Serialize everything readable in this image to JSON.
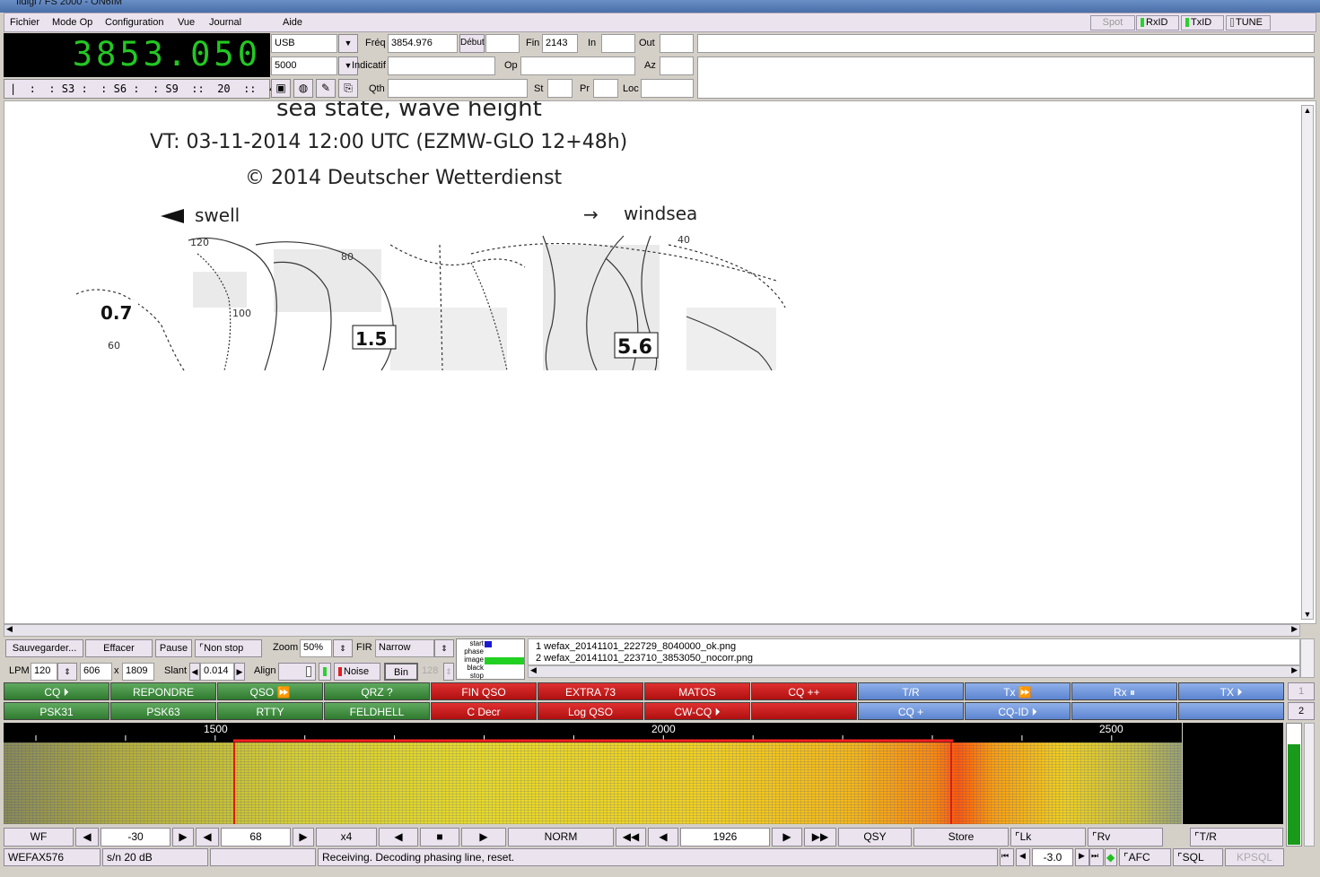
{
  "window": {
    "title": "fldigi / FS 2000 - ON6IM"
  },
  "menu": {
    "items": [
      "Fichier",
      "Mode Op",
      "Configuration",
      "Vue",
      "Journal",
      "Aide"
    ]
  },
  "indicators": {
    "spot": "Spot",
    "rxid": "RxID",
    "txid": "TxID",
    "tune": "TUNE"
  },
  "rig": {
    "frequency": "3853.050",
    "smeter": "|  :  : S3 :  : S6 :  : S9  ::  20  ::  40  ::  |",
    "mode": "USB",
    "bandwidth": "5000"
  },
  "log": {
    "freq_label": "Fréq",
    "freq_value": "3854.976",
    "debut_label": "Début",
    "debut_value": "",
    "fin_label": "Fin",
    "fin_value": "2143",
    "in_label": "In",
    "out_label": "Out",
    "call_label": "Indicatif",
    "op_label": "Op",
    "az_label": "Az",
    "qth_label": "Qth",
    "st_label": "St",
    "pr_label": "Pr",
    "loc_label": "Loc"
  },
  "fax": {
    "line1": "sea state, wave height",
    "line2": "VT: 03-11-2014 12:00 UTC (EZMW-GLO 12+48h)",
    "line3": "© 2014 Deutscher Wetterdienst",
    "legend_swell": "swell",
    "legend_windsea": "windsea",
    "v1": "0.7",
    "v2": "1.5",
    "v3": "5.6",
    "n1": "80",
    "n2": "100",
    "n3": "120",
    "n4": "60",
    "n5": "40"
  },
  "faxctl": {
    "save": "Sauvegarder...",
    "erase": "Effacer",
    "pause": "Pause",
    "nonstop": "Non stop",
    "zoom_label": "Zoom",
    "zoom_value": "50%",
    "fir_label": "FIR",
    "fir_value": "Narrow",
    "lpm_label": "LPM",
    "lpm_value": "120",
    "w_value": "606",
    "x_label": "x",
    "h_value": "1809",
    "slant_label": "Slant",
    "slant_value": "0.014",
    "align_label": "Align",
    "noise": "Noise",
    "bin": "Bin",
    "thresh": "128",
    "states": [
      "start",
      "phase",
      "image",
      "black",
      "stop"
    ],
    "files": [
      "1 wefax_20141101_222729_8040000_ok.png",
      "2 wefax_20141101_223710_3853050_nocorr.png"
    ]
  },
  "macros": {
    "row1": [
      "CQ ⏵",
      "REPONDRE",
      "QSO ⏩",
      "QRZ ?",
      "FIN QSO",
      "EXTRA 73",
      "MATOS",
      "CQ ++",
      "T/R",
      "Tx ⏩",
      "Rx ⏸",
      "TX ⏵"
    ],
    "row2": [
      "PSK31",
      "PSK63",
      "RTTY",
      "FELDHELL",
      "C Decr",
      "Log QSO",
      "CW-CQ ⏵",
      "",
      "CQ +",
      "CQ-ID ⏵",
      "",
      ""
    ],
    "bank1": "1",
    "bank2": "2"
  },
  "waterfall": {
    "ticks": [
      "1500",
      "2000",
      "2500"
    ]
  },
  "wfctl": {
    "wf": "WF",
    "low": "-30",
    "range": "68",
    "x4": "x4",
    "norm": "NORM",
    "offset": "1926",
    "qsy": "QSY",
    "store": "Store",
    "lk": "Lk",
    "rv": "Rv",
    "tr": "T/R"
  },
  "status": {
    "mode": "WEFAX576",
    "sn": "s/n  20 dB",
    "blank": "",
    "msg": "Receiving. Decoding phasing line, reset.",
    "db": "-3.0",
    "afc": "AFC",
    "sql": "SQL",
    "kpsql": "KPSQL"
  }
}
